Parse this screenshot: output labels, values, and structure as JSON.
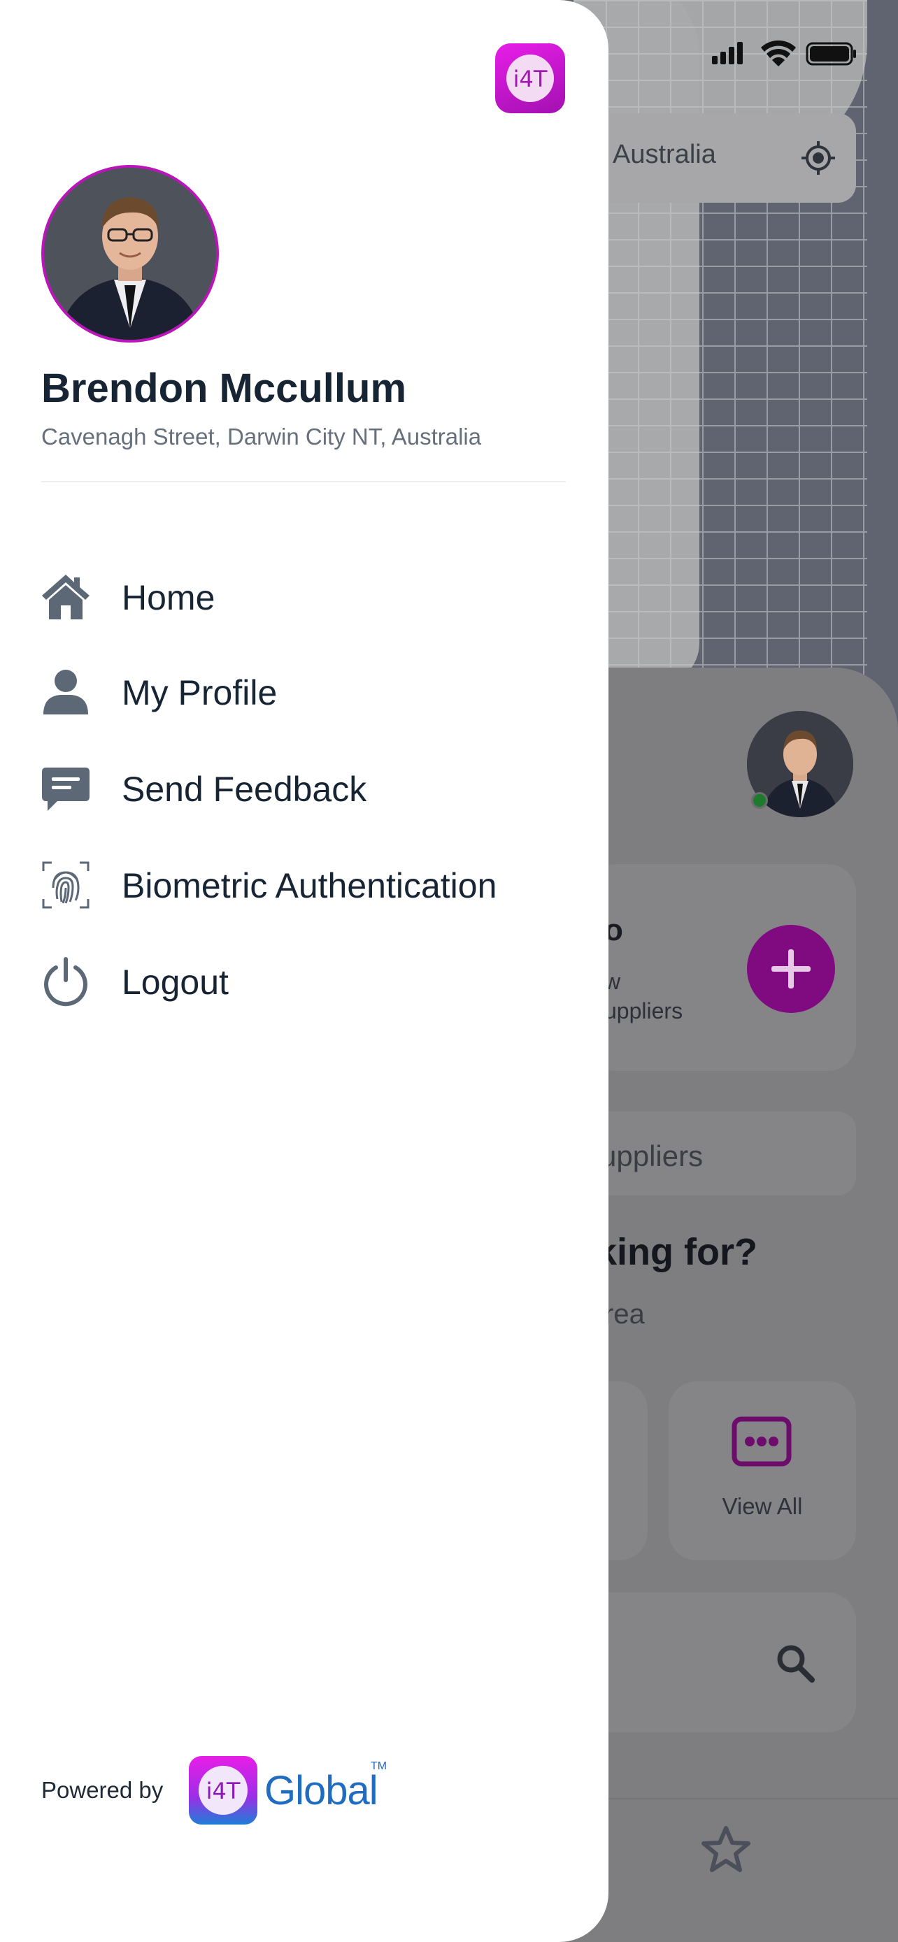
{
  "colors": {
    "accent": "#800B80",
    "name_text": "#172433",
    "secondary_text": "#66707C",
    "online": "#1E7A2C",
    "brand_blue": "#1F6CC0"
  },
  "background": {
    "location_text": "Australia",
    "card": {
      "title": "o",
      "line1": "w",
      "line2": "uppliers"
    },
    "suppliers_pill": "uppliers",
    "question_title": "king for?",
    "question_sub": "rea",
    "view_all_label": "View All"
  },
  "drawer": {
    "app_logo_text": "i4T",
    "user": {
      "name": "Brendon Mccullum",
      "address": "Cavenagh Street, Darwin City NT, Australia"
    },
    "menu": [
      {
        "label": "Home",
        "icon": "home-icon"
      },
      {
        "label": "My Profile",
        "icon": "user-icon"
      },
      {
        "label": "Send Feedback",
        "icon": "feedback-icon"
      },
      {
        "label": "Biometric Authentication",
        "icon": "fingerprint-icon"
      },
      {
        "label": "Logout",
        "icon": "power-icon"
      }
    ],
    "footer": {
      "powered_by": "Powered by",
      "brand_logo_text": "i4T",
      "brand_name": "Global",
      "trademark": "TM"
    }
  }
}
